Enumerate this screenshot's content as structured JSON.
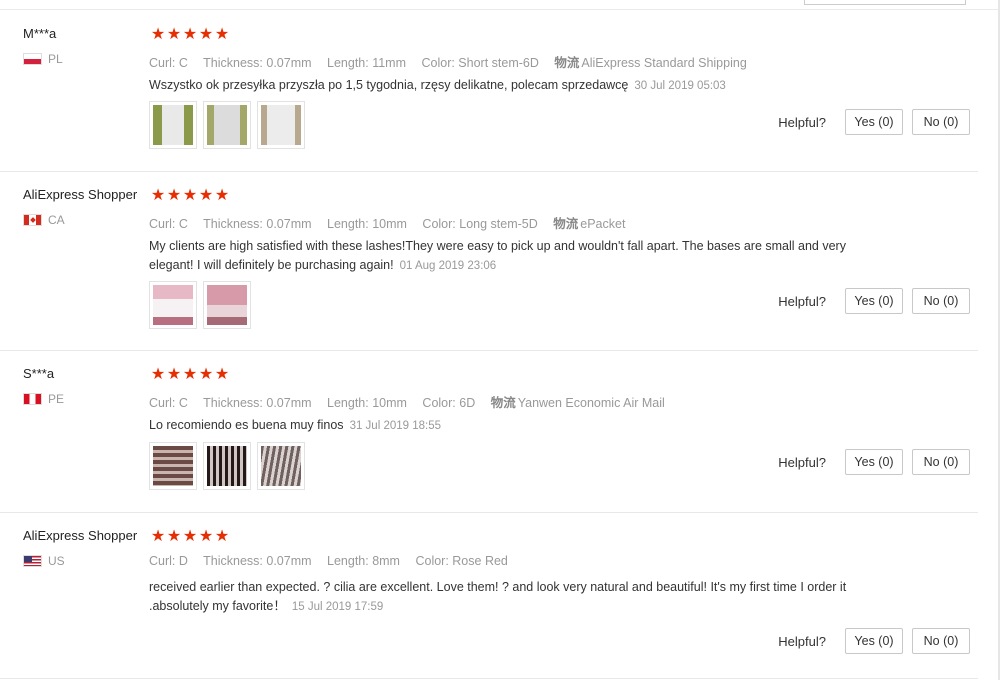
{
  "helpful_label": "Helpful?",
  "reviews": [
    {
      "user": "M***a",
      "country": "PL",
      "flag_icon": "poland-flag-icon",
      "stars": [
        "★",
        "★",
        "★",
        "★",
        "★"
      ],
      "curl": "Curl: C",
      "thickness": "Thickness: 0.07mm",
      "length": "Length: 11mm",
      "color": "Color: Short stem-6D",
      "shipping_icon": "物流",
      "shipping": "AliExpress Standard Shipping",
      "comment": "Wszystko ok przesyłka przyszła po 1,5 tygodnia, rzęsy delikatne, polecam sprzedawcę",
      "date": "30 Jul 2019 05:03",
      "yes": "Yes (0)",
      "no": "No (0)"
    },
    {
      "user": "AliExpress Shopper",
      "country": "CA",
      "flag_icon": "canada-flag-icon",
      "stars": [
        "★",
        "★",
        "★",
        "★",
        "★"
      ],
      "curl": "Curl: C",
      "thickness": "Thickness: 0.07mm",
      "length": "Length: 10mm",
      "color": "Color: Long stem-5D",
      "shipping_icon": "物流",
      "shipping": "ePacket",
      "comment": "My clients are high satisfied with these lashes!They were easy to pick up and wouldn't fall apart. The bases are small and very elegant! I will definitely be purchasing again!",
      "date": "01 Aug 2019 23:06",
      "yes": "Yes (0)",
      "no": "No (0)"
    },
    {
      "user": "S***a",
      "country": "PE",
      "flag_icon": "peru-flag-icon",
      "stars": [
        "★",
        "★",
        "★",
        "★",
        "★"
      ],
      "curl": "Curl: C",
      "thickness": "Thickness: 0.07mm",
      "length": "Length: 10mm",
      "color": "Color: 6D",
      "shipping_icon": "物流",
      "shipping": "Yanwen Economic Air Mail",
      "comment": "Lo recomiendo es buena muy finos",
      "date": "31 Jul 2019 18:55",
      "yes": "Yes (0)",
      "no": "No (0)"
    },
    {
      "user": "AliExpress Shopper",
      "country": "US",
      "flag_icon": "usa-flag-icon",
      "stars": [
        "★",
        "★",
        "★",
        "★",
        "★"
      ],
      "curl": "Curl: D",
      "thickness": "Thickness: 0.07mm",
      "length": "Length: 8mm",
      "color": "Color: Rose Red",
      "comment": "received earlier than expected. ? cilia are excellent. Love them! ? and look very natural and beautiful! It's my first time I order it .absolutely my favorite！",
      "date": "15 Jul 2019 17:59",
      "yes": "Yes (0)",
      "no": "No (0)"
    }
  ]
}
